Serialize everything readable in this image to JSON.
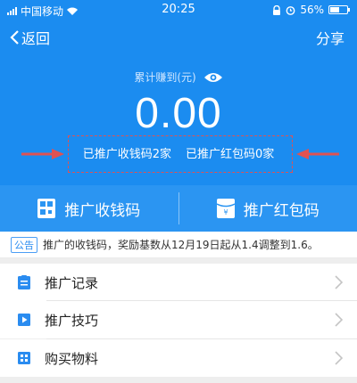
{
  "status_bar": {
    "carrier": "中国移动",
    "time": "20:25",
    "battery": "56%",
    "icons": [
      "signal-icon",
      "wifi-icon",
      "lock-icon",
      "alarm-icon",
      "battery-icon"
    ]
  },
  "nav": {
    "back_label": "返回",
    "share_label": "分享"
  },
  "summary": {
    "earned_label": "累计赚到(元)",
    "amount": "0.00",
    "promoted_collection_codes": "已推广收钱码2家",
    "promoted_red_packet_codes": "已推广红包码0家"
  },
  "actions": [
    {
      "label": "推广收钱码",
      "icon": "qr-code-icon"
    },
    {
      "label": "推广红包码",
      "icon": "red-packet-icon"
    }
  ],
  "notice": {
    "tag": "公告",
    "text": "推广的收钱码，奖励基数从12月19日起从1.4调整到1.6。"
  },
  "menu": [
    {
      "label": "推广记录",
      "icon": "record-icon"
    },
    {
      "label": "推广技巧",
      "icon": "play-icon"
    },
    {
      "label": "购买物料",
      "icon": "materials-icon"
    }
  ],
  "colors": {
    "primary_blue": "#1b8cf0",
    "annotation_red": "#e05252"
  }
}
